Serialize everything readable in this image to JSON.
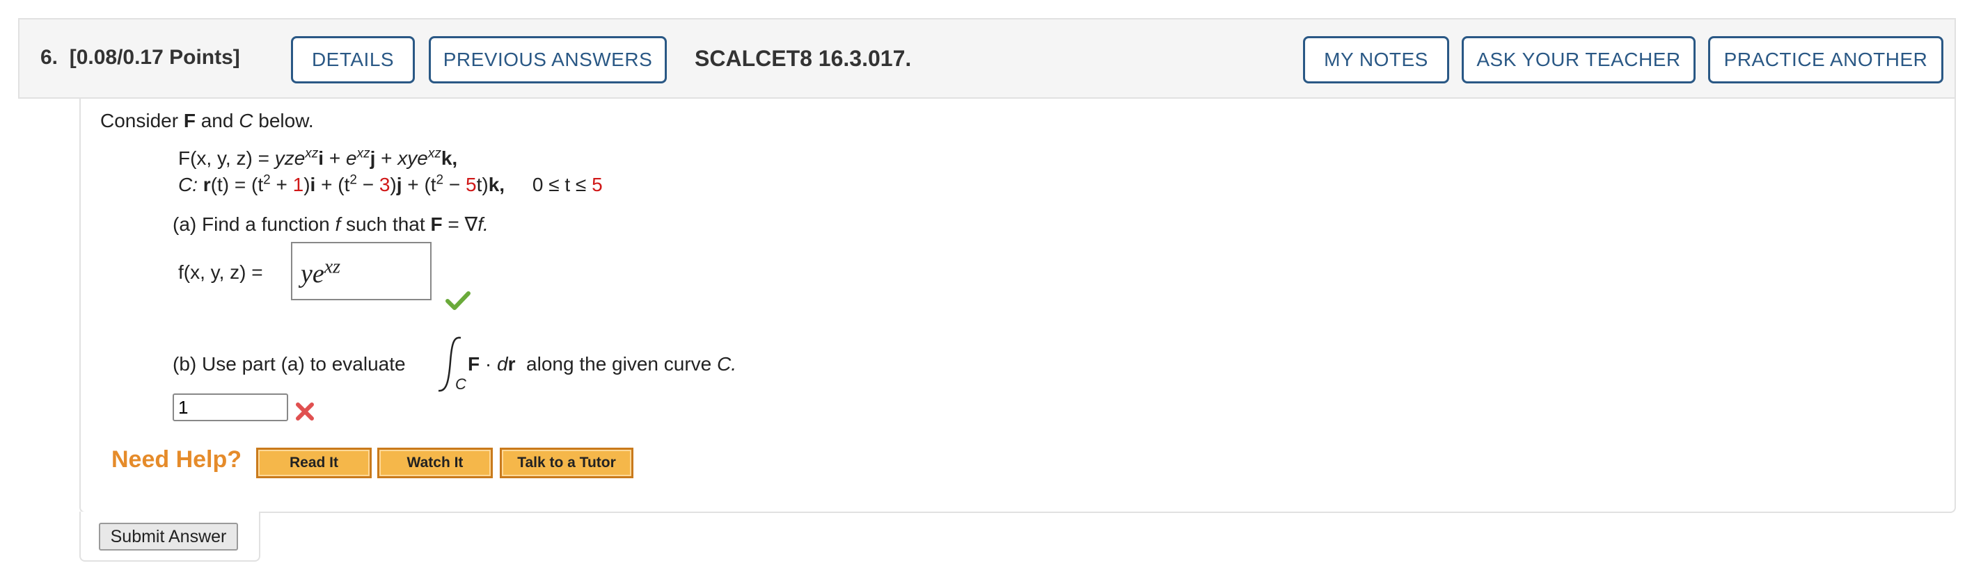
{
  "header": {
    "question_number": "6.",
    "points": "[0.08/0.17 Points]",
    "details_label": "DETAILS",
    "previous_answers_label": "PREVIOUS ANSWERS",
    "question_id": "SCALCET8 16.3.017.",
    "my_notes_label": "MY NOTES",
    "ask_teacher_label": "ASK YOUR TEACHER",
    "practice_another_label": "PRACTICE ANOTHER"
  },
  "problem": {
    "intro_prefix": "Consider",
    "intro_F": "F",
    "intro_and": "and",
    "intro_C": "C",
    "intro_suffix": "below.",
    "field_lhs": "F(x, y, z) =",
    "field_t1": "yze",
    "field_exp1": "xz",
    "field_i": "i",
    "field_plus1": "+",
    "field_t2": "e",
    "field_exp2": "xz",
    "field_j": "j",
    "field_plus2": "+",
    "field_t3": "xye",
    "field_exp3": "xz",
    "field_k": "k,",
    "curve_label": "C:",
    "curve_r": "r",
    "curve_eq": "(t) = (t",
    "curve_exp1": "2",
    "curve_plus1": " + ",
    "curve_n1": "1",
    "curve_i_close": ")",
    "curve_i": "i",
    "curve_plus2": " + (t",
    "curve_exp2": "2",
    "curve_minus1": " − ",
    "curve_n2": "3",
    "curve_j_close": ")",
    "curve_j": "j",
    "curve_plus3": " + (t",
    "curve_exp3": "2",
    "curve_minus2": " − ",
    "curve_n3": "5",
    "curve_k_close": "t)",
    "curve_k": "k,",
    "range": "0 ≤ t ≤ ",
    "range_end": "5"
  },
  "part_a": {
    "prompt_prefix": "(a) Find a function",
    "prompt_f": "f",
    "prompt_mid": "such that",
    "prompt_F": "F",
    "prompt_eq": "= ∇",
    "prompt_f2": "f.",
    "lhs": "f(x, y, z) =",
    "answer_base": "ye",
    "answer_exp": "xz",
    "status": "correct"
  },
  "part_b": {
    "prompt_prefix": "(b) Use part (a) to evaluate",
    "integral_sub": "C",
    "integrand_F": "F",
    "integrand_dot": "·",
    "integrand_d": "d",
    "integrand_r": "r",
    "prompt_suffix": "along the given curve",
    "prompt_C": "C.",
    "answer_value": "1",
    "status": "incorrect"
  },
  "help": {
    "title": "Need Help?",
    "read_it": "Read It",
    "watch_it": "Watch It",
    "talk_tutor": "Talk to a Tutor"
  },
  "submit_label": "Submit Answer",
  "colors": {
    "button_border": "#2a5885",
    "accent_orange": "#e58b2a",
    "value_red": "#d01818",
    "correct_green": "#6aaa3a",
    "incorrect_red": "#e05050"
  }
}
